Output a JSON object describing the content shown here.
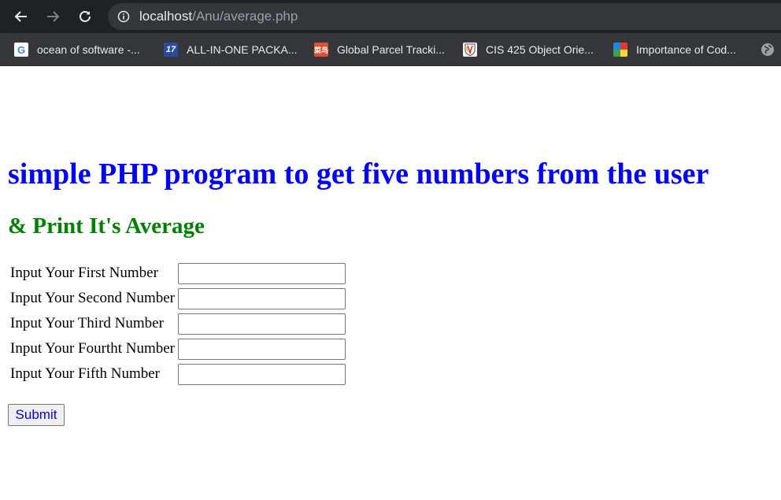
{
  "browser": {
    "url_host": "localhost",
    "url_path": "/Anu/average.php",
    "bookmarks": [
      {
        "label": "ocean of software -...",
        "icon": "google-icon"
      },
      {
        "label": "ALL-IN-ONE PACKA...",
        "icon": "17track-icon",
        "icon_text": "17"
      },
      {
        "label": "Global Parcel Tracki...",
        "icon": "cainiao-icon",
        "icon_text": "菜鸟"
      },
      {
        "label": "CIS 425 Object Orie...",
        "icon": "school-crest-icon"
      },
      {
        "label": "Importance of Cod...",
        "icon": "colorful-ball-icon"
      }
    ]
  },
  "page": {
    "title": "simple PHP program to get five numbers from the user",
    "subtitle": "& Print It's Average",
    "title_color": "#0000ff",
    "subtitle_color": "#008000",
    "fields": [
      {
        "label": "Input Your First Number",
        "value": ""
      },
      {
        "label": "Input Your Second Number",
        "value": ""
      },
      {
        "label": "Input Your Third Number",
        "value": ""
      },
      {
        "label": "Input Your Fourtht Number",
        "value": ""
      },
      {
        "label": "Input Your Fifth Number",
        "value": ""
      }
    ],
    "submit_label": "Submit"
  }
}
